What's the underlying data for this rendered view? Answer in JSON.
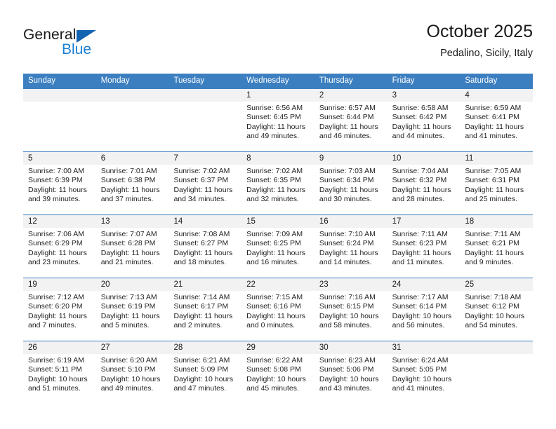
{
  "brand": {
    "name_part1": "General",
    "name_part2": "Blue",
    "triangle_color": "#1263b0",
    "blue_color": "#1a7fd4"
  },
  "header": {
    "title": "October 2025",
    "subtitle": "Pedalino, Sicily, Italy"
  },
  "theme": {
    "header_row_bg": "#3c7fc1",
    "day_number_bg": "#f2f2f2",
    "text_color": "#232323"
  },
  "weekdays": [
    "Sunday",
    "Monday",
    "Tuesday",
    "Wednesday",
    "Thursday",
    "Friday",
    "Saturday"
  ],
  "weeks": [
    [
      {
        "day": "",
        "sunrise": "",
        "sunset": "",
        "daylight": ""
      },
      {
        "day": "",
        "sunrise": "",
        "sunset": "",
        "daylight": ""
      },
      {
        "day": "",
        "sunrise": "",
        "sunset": "",
        "daylight": ""
      },
      {
        "day": "1",
        "sunrise": "Sunrise: 6:56 AM",
        "sunset": "Sunset: 6:45 PM",
        "daylight": "Daylight: 11 hours and 49 minutes."
      },
      {
        "day": "2",
        "sunrise": "Sunrise: 6:57 AM",
        "sunset": "Sunset: 6:44 PM",
        "daylight": "Daylight: 11 hours and 46 minutes."
      },
      {
        "day": "3",
        "sunrise": "Sunrise: 6:58 AM",
        "sunset": "Sunset: 6:42 PM",
        "daylight": "Daylight: 11 hours and 44 minutes."
      },
      {
        "day": "4",
        "sunrise": "Sunrise: 6:59 AM",
        "sunset": "Sunset: 6:41 PM",
        "daylight": "Daylight: 11 hours and 41 minutes."
      }
    ],
    [
      {
        "day": "5",
        "sunrise": "Sunrise: 7:00 AM",
        "sunset": "Sunset: 6:39 PM",
        "daylight": "Daylight: 11 hours and 39 minutes."
      },
      {
        "day": "6",
        "sunrise": "Sunrise: 7:01 AM",
        "sunset": "Sunset: 6:38 PM",
        "daylight": "Daylight: 11 hours and 37 minutes."
      },
      {
        "day": "7",
        "sunrise": "Sunrise: 7:02 AM",
        "sunset": "Sunset: 6:37 PM",
        "daylight": "Daylight: 11 hours and 34 minutes."
      },
      {
        "day": "8",
        "sunrise": "Sunrise: 7:02 AM",
        "sunset": "Sunset: 6:35 PM",
        "daylight": "Daylight: 11 hours and 32 minutes."
      },
      {
        "day": "9",
        "sunrise": "Sunrise: 7:03 AM",
        "sunset": "Sunset: 6:34 PM",
        "daylight": "Daylight: 11 hours and 30 minutes."
      },
      {
        "day": "10",
        "sunrise": "Sunrise: 7:04 AM",
        "sunset": "Sunset: 6:32 PM",
        "daylight": "Daylight: 11 hours and 28 minutes."
      },
      {
        "day": "11",
        "sunrise": "Sunrise: 7:05 AM",
        "sunset": "Sunset: 6:31 PM",
        "daylight": "Daylight: 11 hours and 25 minutes."
      }
    ],
    [
      {
        "day": "12",
        "sunrise": "Sunrise: 7:06 AM",
        "sunset": "Sunset: 6:29 PM",
        "daylight": "Daylight: 11 hours and 23 minutes."
      },
      {
        "day": "13",
        "sunrise": "Sunrise: 7:07 AM",
        "sunset": "Sunset: 6:28 PM",
        "daylight": "Daylight: 11 hours and 21 minutes."
      },
      {
        "day": "14",
        "sunrise": "Sunrise: 7:08 AM",
        "sunset": "Sunset: 6:27 PM",
        "daylight": "Daylight: 11 hours and 18 minutes."
      },
      {
        "day": "15",
        "sunrise": "Sunrise: 7:09 AM",
        "sunset": "Sunset: 6:25 PM",
        "daylight": "Daylight: 11 hours and 16 minutes."
      },
      {
        "day": "16",
        "sunrise": "Sunrise: 7:10 AM",
        "sunset": "Sunset: 6:24 PM",
        "daylight": "Daylight: 11 hours and 14 minutes."
      },
      {
        "day": "17",
        "sunrise": "Sunrise: 7:11 AM",
        "sunset": "Sunset: 6:23 PM",
        "daylight": "Daylight: 11 hours and 11 minutes."
      },
      {
        "day": "18",
        "sunrise": "Sunrise: 7:11 AM",
        "sunset": "Sunset: 6:21 PM",
        "daylight": "Daylight: 11 hours and 9 minutes."
      }
    ],
    [
      {
        "day": "19",
        "sunrise": "Sunrise: 7:12 AM",
        "sunset": "Sunset: 6:20 PM",
        "daylight": "Daylight: 11 hours and 7 minutes."
      },
      {
        "day": "20",
        "sunrise": "Sunrise: 7:13 AM",
        "sunset": "Sunset: 6:19 PM",
        "daylight": "Daylight: 11 hours and 5 minutes."
      },
      {
        "day": "21",
        "sunrise": "Sunrise: 7:14 AM",
        "sunset": "Sunset: 6:17 PM",
        "daylight": "Daylight: 11 hours and 2 minutes."
      },
      {
        "day": "22",
        "sunrise": "Sunrise: 7:15 AM",
        "sunset": "Sunset: 6:16 PM",
        "daylight": "Daylight: 11 hours and 0 minutes."
      },
      {
        "day": "23",
        "sunrise": "Sunrise: 7:16 AM",
        "sunset": "Sunset: 6:15 PM",
        "daylight": "Daylight: 10 hours and 58 minutes."
      },
      {
        "day": "24",
        "sunrise": "Sunrise: 7:17 AM",
        "sunset": "Sunset: 6:14 PM",
        "daylight": "Daylight: 10 hours and 56 minutes."
      },
      {
        "day": "25",
        "sunrise": "Sunrise: 7:18 AM",
        "sunset": "Sunset: 6:12 PM",
        "daylight": "Daylight: 10 hours and 54 minutes."
      }
    ],
    [
      {
        "day": "26",
        "sunrise": "Sunrise: 6:19 AM",
        "sunset": "Sunset: 5:11 PM",
        "daylight": "Daylight: 10 hours and 51 minutes."
      },
      {
        "day": "27",
        "sunrise": "Sunrise: 6:20 AM",
        "sunset": "Sunset: 5:10 PM",
        "daylight": "Daylight: 10 hours and 49 minutes."
      },
      {
        "day": "28",
        "sunrise": "Sunrise: 6:21 AM",
        "sunset": "Sunset: 5:09 PM",
        "daylight": "Daylight: 10 hours and 47 minutes."
      },
      {
        "day": "29",
        "sunrise": "Sunrise: 6:22 AM",
        "sunset": "Sunset: 5:08 PM",
        "daylight": "Daylight: 10 hours and 45 minutes."
      },
      {
        "day": "30",
        "sunrise": "Sunrise: 6:23 AM",
        "sunset": "Sunset: 5:06 PM",
        "daylight": "Daylight: 10 hours and 43 minutes."
      },
      {
        "day": "31",
        "sunrise": "Sunrise: 6:24 AM",
        "sunset": "Sunset: 5:05 PM",
        "daylight": "Daylight: 10 hours and 41 minutes."
      },
      {
        "day": "",
        "sunrise": "",
        "sunset": "",
        "daylight": ""
      }
    ]
  ]
}
